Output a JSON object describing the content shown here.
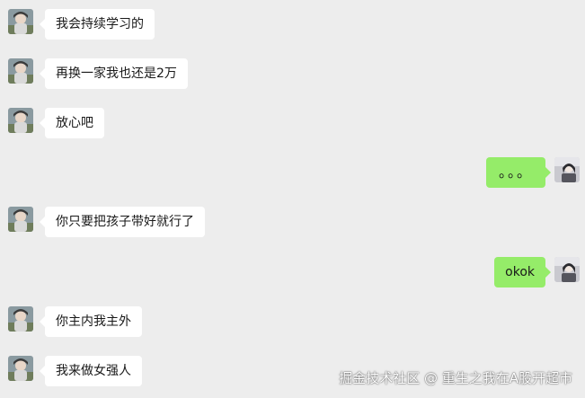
{
  "messages": [
    {
      "side": "left",
      "text": "我会持续学习的"
    },
    {
      "side": "left",
      "text": "再换一家我也还是2万"
    },
    {
      "side": "left",
      "text": "放心吧"
    },
    {
      "side": "right",
      "text": "。。。"
    },
    {
      "side": "left",
      "text": "你只要把孩子带好就行了"
    },
    {
      "side": "right",
      "text": "okok"
    },
    {
      "side": "left",
      "text": "你主内我主外"
    },
    {
      "side": "left",
      "text": "我来做女强人"
    }
  ],
  "watermark": "掘金技术社区 @ 重生之我在A股开超市",
  "colors": {
    "background": "#ededed",
    "incoming_bubble": "#ffffff",
    "outgoing_bubble": "#95ec69",
    "text": "#191919"
  },
  "avatars": {
    "contact": "contact-avatar-icon",
    "self": "self-avatar-icon"
  }
}
